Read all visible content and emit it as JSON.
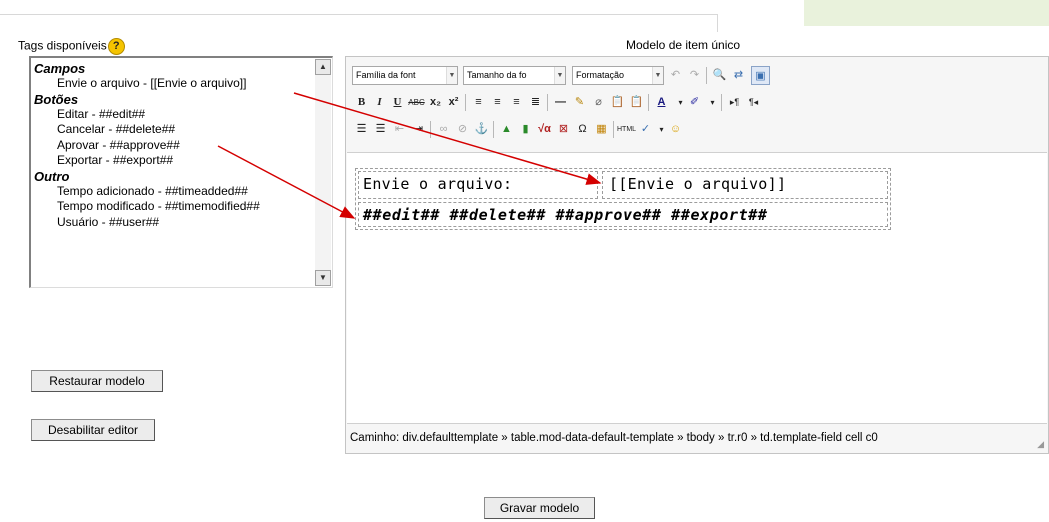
{
  "header": {
    "tags_label": "Tags disponíveis",
    "help_icon": "?",
    "model_title": "Modelo de item único"
  },
  "taglist": {
    "groups": [
      {
        "title": "Campos",
        "items": [
          "Envie o arquivo - [[Envie o arquivo]]"
        ]
      },
      {
        "title": "Botões",
        "items": [
          "Editar - ##edit##",
          "Cancelar - ##delete##",
          "Aprovar - ##approve##",
          "Exportar - ##export##"
        ]
      },
      {
        "title": "Outro",
        "items": [
          "Tempo adicionado - ##timeadded##",
          "Tempo modificado - ##timemodified##",
          "Usuário - ##user##"
        ]
      }
    ]
  },
  "buttons": {
    "restore": "Restaurar modelo",
    "disable_editor": "Desabilitar editor",
    "save": "Gravar modelo"
  },
  "toolbar": {
    "font_family": "Família da font",
    "font_size": "Tamanho da fo",
    "format": "Formatação"
  },
  "editor": {
    "field_label": "Envie o arquivo:",
    "field_tag": "[[Envie o arquivo]]",
    "buttons_row": "##edit## ##delete## ##approve## ##export##",
    "path": "Caminho: div.defaulttemplate » table.mod-data-default-template » tbody » tr.r0 » td.template-field cell c0"
  },
  "colors": {
    "arrow": "#d40000",
    "help_icon": "#f5c400",
    "top_panel": "#e9f2dc"
  }
}
